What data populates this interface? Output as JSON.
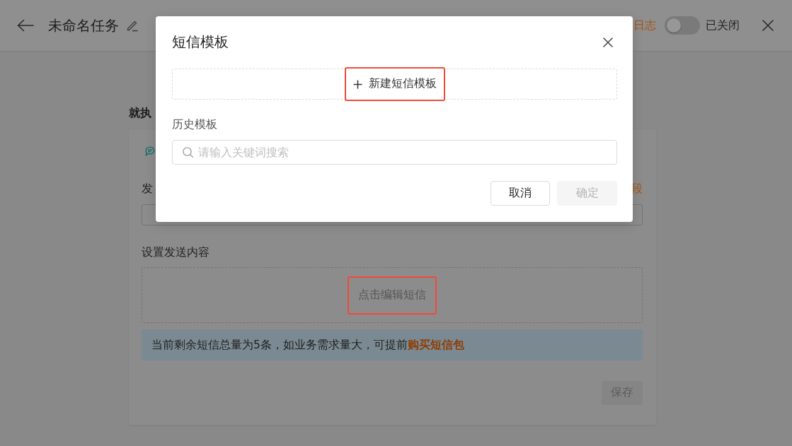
{
  "header": {
    "title": "未命名任务",
    "log_link": "日志",
    "toggle": {
      "on": false,
      "label": "已关闭"
    }
  },
  "page": {
    "section_title": "就执",
    "card": {
      "field_label": "发",
      "field_link": "段",
      "content_label": "设置发送内容",
      "edit_prompt": {
        "text": "点击编辑短信",
        "highlighted": true
      },
      "notice": {
        "text": "当前剩余短信总量为5条，如业务需求量大，可提前",
        "link": "购买短信包"
      },
      "save_button": {
        "label": "保存",
        "disabled": true
      }
    }
  },
  "dialog": {
    "title": "短信模板",
    "new_template_button": {
      "label": "新建短信模板",
      "highlighted": true
    },
    "history_label": "历史模板",
    "search": {
      "placeholder": "请输入关键词搜索"
    },
    "buttons": [
      {
        "label": "取消",
        "kind": "secondary",
        "disabled": false
      },
      {
        "label": "确定",
        "kind": "primary",
        "disabled": true
      }
    ]
  }
}
